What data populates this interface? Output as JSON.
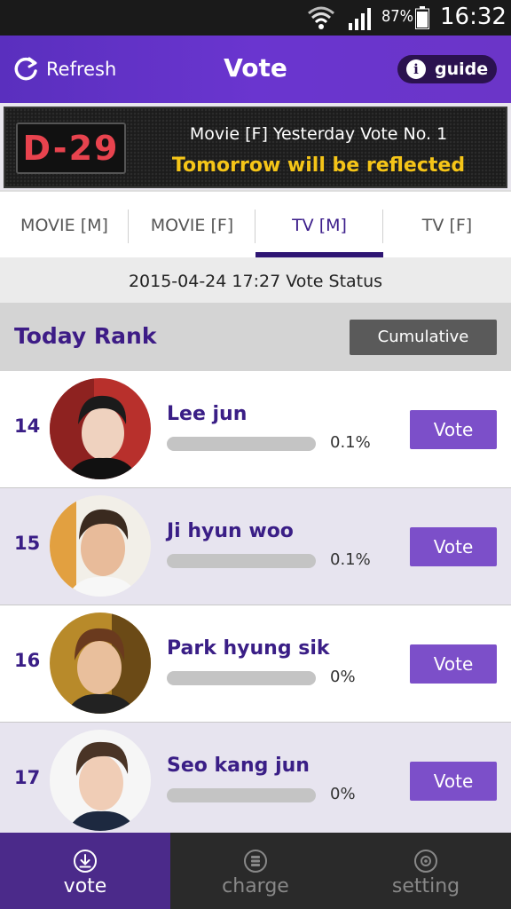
{
  "status_bar": {
    "battery_percent": "87%",
    "time": "16:32"
  },
  "header": {
    "refresh_label": "Refresh",
    "title": "Vote",
    "guide_label": "guide",
    "guide_icon_glyph": "i"
  },
  "banner": {
    "dday": "D-29",
    "line1": "Movie [F] Yesterday Vote No. 1",
    "line2": "Tomorrow will be reflected",
    "line2_color": "#f5c518",
    "dday_color": "#e8434e"
  },
  "tabs": [
    {
      "label": "MOVIE [M]",
      "active": false
    },
    {
      "label": "MOVIE [F]",
      "active": false
    },
    {
      "label": "TV [M]",
      "active": true
    },
    {
      "label": "TV [F]",
      "active": false
    }
  ],
  "vote_status": "2015-04-24 17:27 Vote Status",
  "rank_header": {
    "title": "Today Rank",
    "cumulative_label": "Cumulative"
  },
  "list": [
    {
      "rank": "14",
      "name": "Lee jun",
      "percent": "0.1%",
      "fill_fraction": 0.0,
      "vote_label": "Vote"
    },
    {
      "rank": "15",
      "name": "Ji hyun woo",
      "percent": "0.1%",
      "fill_fraction": 0.0,
      "vote_label": "Vote"
    },
    {
      "rank": "16",
      "name": "Park hyung sik",
      "percent": "0%",
      "fill_fraction": 0.0,
      "vote_label": "Vote"
    },
    {
      "rank": "17",
      "name": "Seo kang jun",
      "percent": "0%",
      "fill_fraction": 0.0,
      "vote_label": "Vote"
    }
  ],
  "bottom_nav": [
    {
      "label": "vote",
      "icon": "download-circle-icon",
      "active": true
    },
    {
      "label": "charge",
      "icon": "coins-icon",
      "active": false
    },
    {
      "label": "setting",
      "icon": "gear-icon",
      "active": false
    }
  ],
  "colors": {
    "accent": "#6a35cf",
    "vote_button": "#7c4fc9",
    "rank_text": "#3a1e86"
  }
}
